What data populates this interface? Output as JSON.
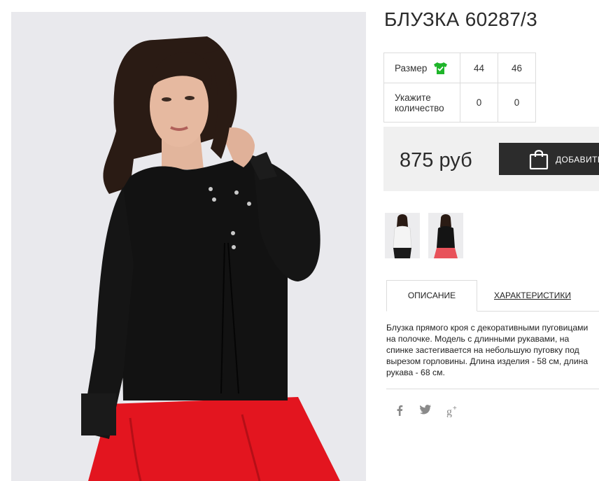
{
  "product": {
    "title": "БЛУЗКА 60287/3"
  },
  "size_table": {
    "size_label": "Размер",
    "sizes": [
      "44",
      "46"
    ],
    "qty_label": "Укажите количество",
    "quantities": [
      "0",
      "0"
    ],
    "size_icon": "tshirt-check-icon",
    "size_icon_color": "#1fb52a"
  },
  "purchase": {
    "price": "875 руб",
    "add_button_label": "ДОБАВИТЬ",
    "add_button_icon": "shopping-bag-icon"
  },
  "tabs": {
    "active": "ОПИСАНИЕ",
    "other": "ХАРАКТЕРИСТИКИ"
  },
  "description": "Блузка прямого кроя с декоративными пуговицами на полочке. Модель с длинными рукавами, на спинке застегивается на небольшую пуговку под вырезом горловины. Длина изделия - 58 см, длина рукава - 68 см.",
  "social": [
    {
      "icon": "facebook-icon",
      "glyph": "f"
    },
    {
      "icon": "twitter-icon",
      "glyph": ""
    },
    {
      "icon": "google-plus-icon",
      "glyph": "g+"
    }
  ],
  "colors": {
    "blouse": "#111111",
    "skirt": "#e3151f",
    "button_bg": "#2c2c2c",
    "panel_bg": "#f0f0f0"
  }
}
